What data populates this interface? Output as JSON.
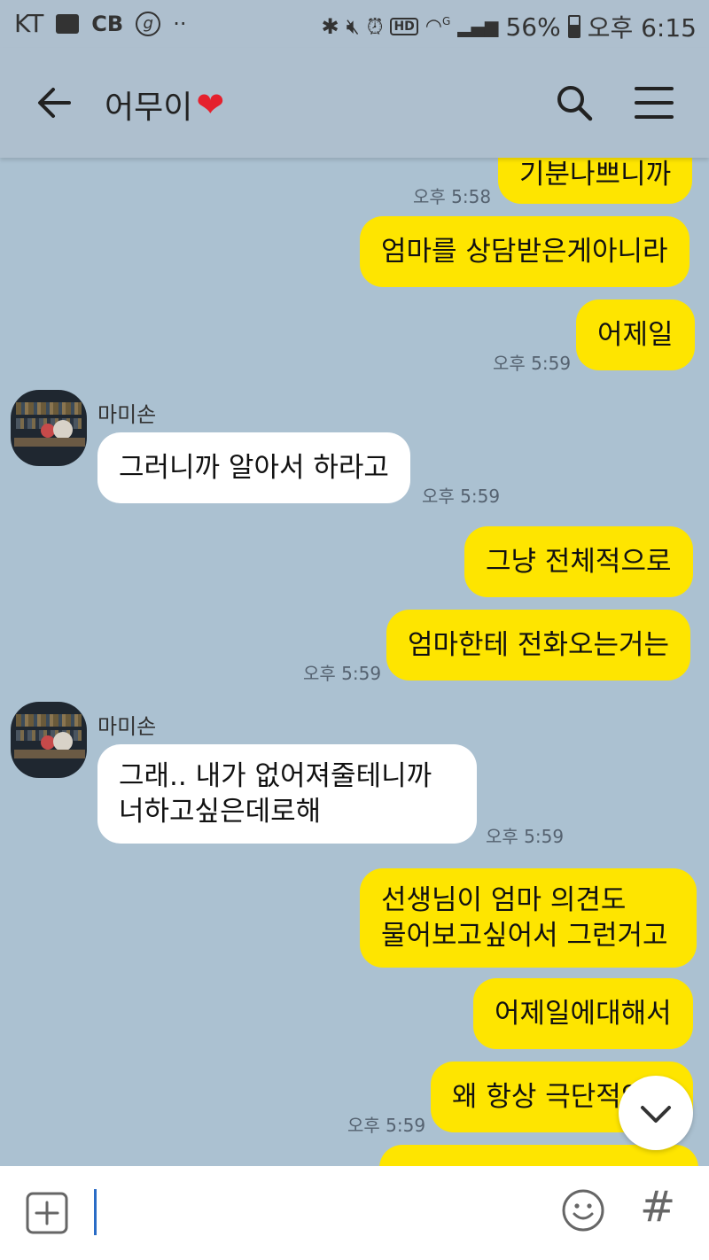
{
  "status_bar": {
    "carrier": "KT",
    "cb_label": "CB",
    "g_label": "g",
    "dots": "··",
    "hd_label": "HD",
    "network": "G",
    "battery": "56%",
    "time": "오후 6:15"
  },
  "header": {
    "title": "어무이",
    "heart": "❤"
  },
  "messages": [
    {
      "side": "me",
      "text": "기분나쁘니까",
      "time": "오후 5:58"
    },
    {
      "side": "me",
      "text": "엄마를 상담받은게아니라"
    },
    {
      "side": "me",
      "text": "어제일",
      "time": "오후 5:59"
    },
    {
      "side": "other",
      "sender": "마미손",
      "text": "그러니까 알아서 하라고",
      "time": "오후 5:59"
    },
    {
      "side": "me",
      "text": "그냥 전체적으로"
    },
    {
      "side": "me",
      "text": "엄마한테 전화오는거는",
      "time": "오후 5:59"
    },
    {
      "side": "other",
      "sender": "마미손",
      "lines": [
        "그래..  내가 없어져줄테니까",
        "너하고싶은데로해"
      ],
      "time": "오후 5:59"
    },
    {
      "side": "me",
      "lines": [
        "선생님이 엄마 의견도",
        "물어보고싶어서 그런거고"
      ]
    },
    {
      "side": "me",
      "text": "어제일에대해서"
    },
    {
      "side": "me",
      "text": "왜 항상 극단적인데",
      "time": "오후 5:59"
    }
  ],
  "input": {
    "placeholder": "",
    "hash": "#"
  },
  "colors": {
    "chat_bg": "#abc1d1",
    "my_bubble": "#fee500",
    "other_bubble": "#ffffff",
    "header_bg": "#aebfce"
  }
}
